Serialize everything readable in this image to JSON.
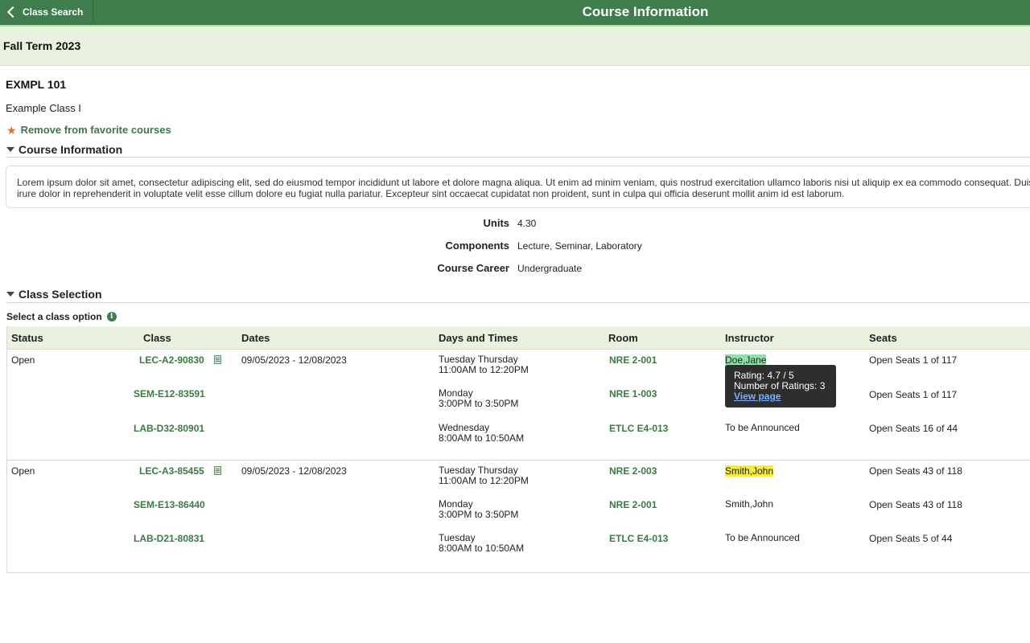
{
  "header": {
    "back_label": "Class Search",
    "title": "Course Information"
  },
  "term": "Fall Term 2023",
  "course": {
    "code": "EXMPL 101",
    "name": "Example Class I",
    "favorite_label": "Remove from favorite courses"
  },
  "sections": {
    "course_info": "Course Information",
    "class_selection": "Class Selection"
  },
  "description": "Lorem ipsum dolor sit amet, consectetur adipiscing elit, sed do eiusmod tempor incididunt ut labore et dolore magna aliqua. Ut enim ad minim veniam, quis nostrud exercitation ullamco laboris nisi ut aliquip ex ea commodo consequat. Duis aute irure dolor in reprehenderit in voluptate velit esse cillum dolore eu fugiat nulla pariatur. Excepteur sint occaecat cupidatat non proident, sunt in culpa qui officia deserunt mollit anim id est laborum.",
  "details": {
    "units_label": "Units",
    "units": "4.30",
    "components_label": "Components",
    "components": "Lecture, Seminar, Laboratory",
    "career_label": "Course Career",
    "career": "Undergraduate"
  },
  "select_prompt": "Select a class option",
  "table": {
    "headers": [
      "Status",
      "Class",
      "Dates",
      "Days and Times",
      "Room",
      "Instructor",
      "Seats"
    ],
    "groups": [
      {
        "status": "Open",
        "dates": "09/05/2023 - 12/08/2023",
        "rows": [
          {
            "class": "LEC-A2-90830",
            "days": "Tuesday Thursday",
            "times": "11:00AM to 12:20PM",
            "room": "NRE 2-001",
            "instructor": "Doe,Jane",
            "seats": "Open Seats 1 of 117"
          },
          {
            "class": "SEM-E12-83591",
            "days": "Monday",
            "times": "3:00PM to 3:50PM",
            "room": "NRE 1-003",
            "instructor": "",
            "seats": "Open Seats 1 of 117"
          },
          {
            "class": "LAB-D32-80901",
            "days": "Wednesday",
            "times": "8:00AM to 10:50AM",
            "room": "ETLC E4-013",
            "instructor": "To be Announced",
            "seats": "Open Seats 16 of 44"
          }
        ]
      },
      {
        "status": "Open",
        "dates": "09/05/2023 - 12/08/2023",
        "rows": [
          {
            "class": "LEC-A3-85455",
            "days": "Tuesday Thursday",
            "times": "11:00AM to 12:20PM",
            "room": "NRE 2-003",
            "instructor": "Smith,John",
            "seats": "Open Seats 43 of 118"
          },
          {
            "class": "SEM-E13-86440",
            "days": "Monday",
            "times": "3:00PM to 3:50PM",
            "room": "NRE 2-001",
            "instructor": "Smith,John",
            "seats": "Open Seats 43 of 118"
          },
          {
            "class": "LAB-D21-80831",
            "days": "Tuesday",
            "times": "8:00AM to 10:50AM",
            "room": "ETLC E4-013",
            "instructor": "To be Announced",
            "seats": "Open Seats 5 of 44"
          }
        ]
      }
    ]
  },
  "tooltip": {
    "rating": "Rating: 4.7 / 5",
    "count": "Number of Ratings: 3",
    "link": "View page"
  }
}
